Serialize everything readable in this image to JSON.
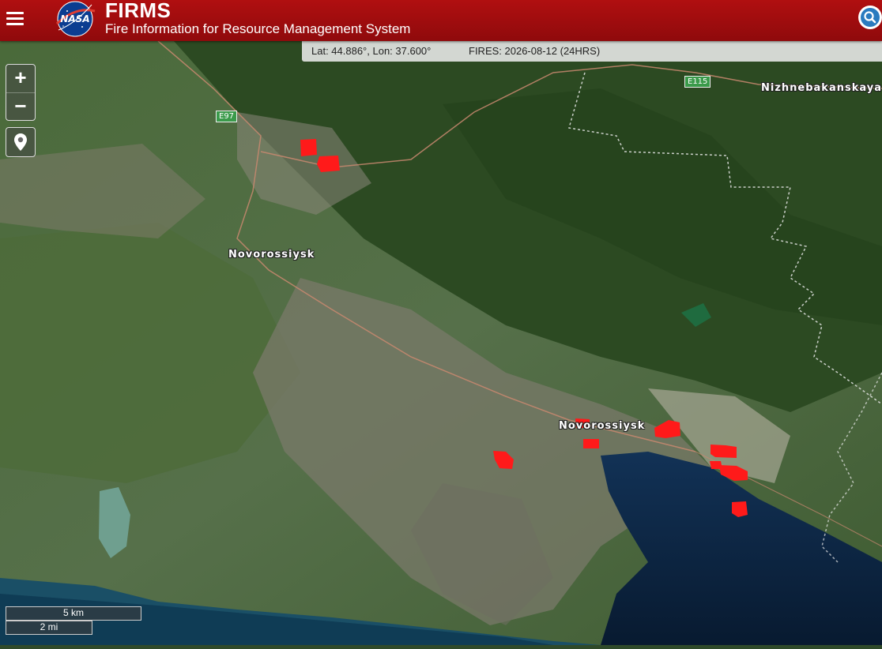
{
  "header": {
    "logo_text": "NASA",
    "brand": "FIRMS",
    "subtitle": "Fire Information for Resource Management System"
  },
  "infobar": {
    "coords": "Lat: 44.886°, Lon: 37.600°",
    "fires": "FIRES: 2026-08-12 (24HRS)"
  },
  "controls": {
    "zoom_in": "+",
    "zoom_out": "−"
  },
  "map_labels": {
    "city_west": "Novorossiysk",
    "city_center": "Novorossiysk",
    "village": "Nizhnebakanskaya",
    "road_e97": "E97",
    "road_e115": "E115"
  },
  "scale": {
    "km": "5 km",
    "mi": "2 mi"
  },
  "colors": {
    "header": "#a50d0e",
    "fire": "#ff1a1a",
    "forest": "#2f4f25",
    "sea": "#0d2540"
  },
  "icons": [
    "menu-icon",
    "nasa-logo",
    "search-globe-icon",
    "location-pin-icon"
  ]
}
